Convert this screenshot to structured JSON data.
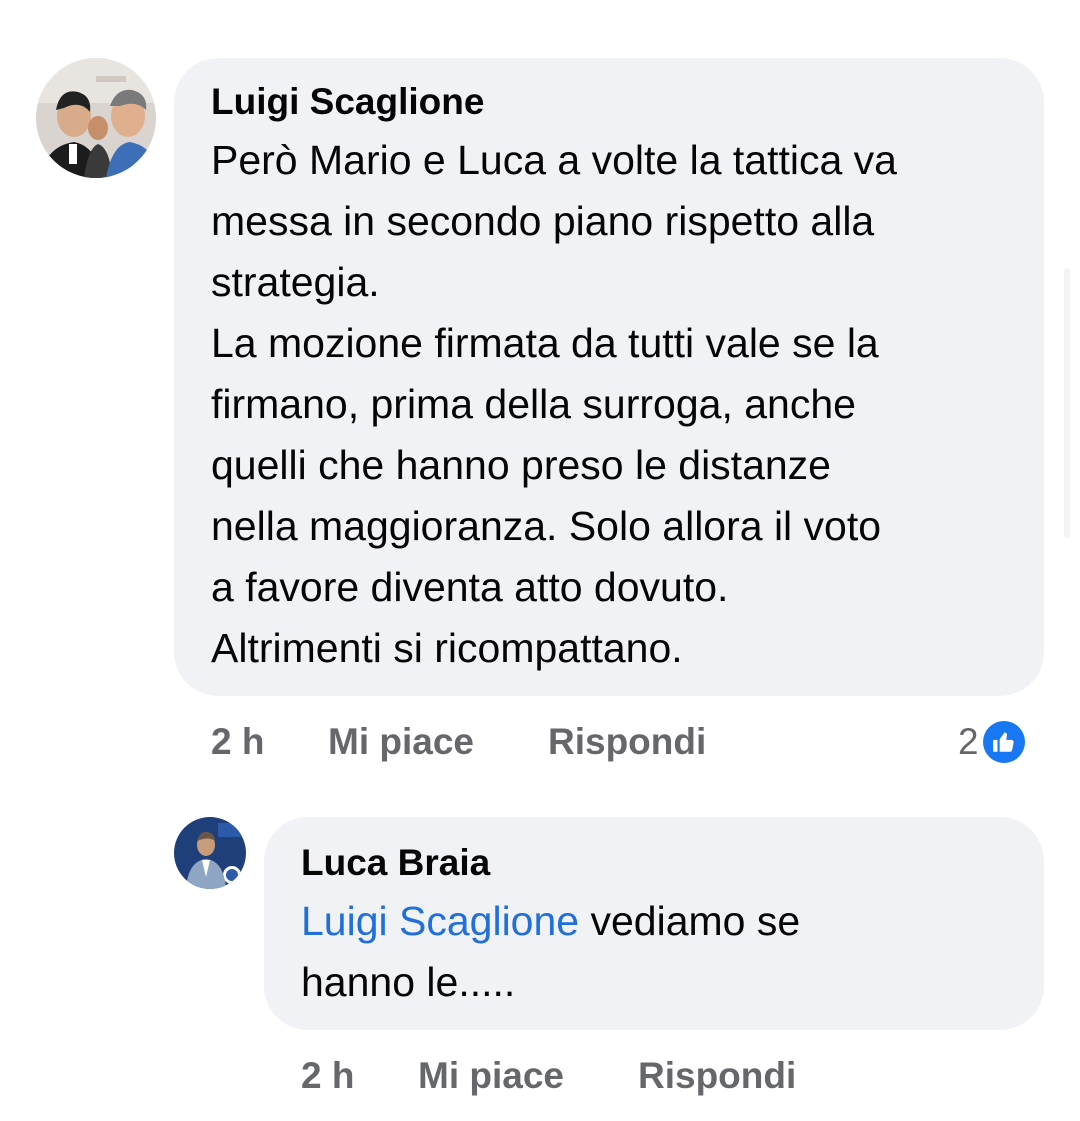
{
  "comment": {
    "author": "Luigi Scaglione",
    "text_lines": [
      "Però Mario e Luca a volte la tattica va",
      "messa in secondo piano rispetto alla",
      "strategia.",
      "La mozione firmata da tutti vale se la",
      "firmano, prima della surroga, anche",
      "quelli che hanno preso le distanze",
      "nella maggioranza. Solo allora il voto",
      "a favore diventa atto dovuto.",
      "Altrimenti si ricompattano."
    ],
    "time": "2 h",
    "like_label": "Mi piace",
    "reply_label": "Rispondi",
    "reaction_count": "2",
    "reaction_icon": "thumbs-up-icon",
    "avatar_icon": "group-photo-avatar"
  },
  "reply": {
    "author": "Luca Braia",
    "mention": "Luigi Scaglione",
    "text_line1_rest": " vediamo se",
    "text_line2": "hanno le.....",
    "time": "2 h",
    "like_label": "Mi piace",
    "reply_label": "Rispondi",
    "avatar_icon": "profile-photo-avatar"
  },
  "colors": {
    "bubble": "#f0f2f5",
    "mention": "#216fdb",
    "meta_text": "#65676b",
    "like_blue": "#1877f2"
  }
}
